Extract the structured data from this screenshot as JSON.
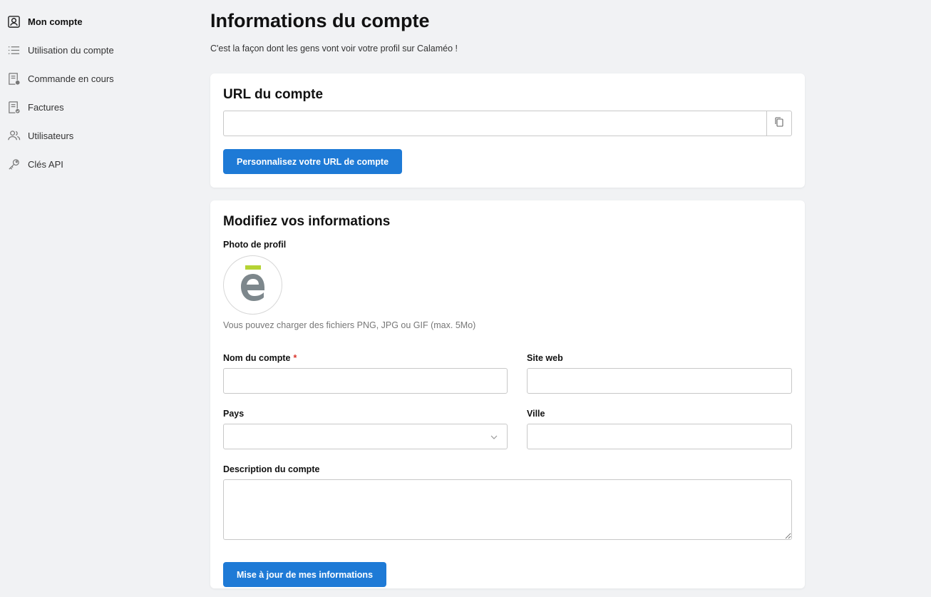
{
  "sidebar": {
    "items": [
      {
        "label": "Mon compte",
        "icon": "account-box-icon",
        "active": true
      },
      {
        "label": "Utilisation du compte",
        "icon": "list-icon"
      },
      {
        "label": "Commande en cours",
        "icon": "order-document-icon"
      },
      {
        "label": "Factures",
        "icon": "invoice-icon"
      },
      {
        "label": "Utilisateurs",
        "icon": "users-icon"
      },
      {
        "label": "Clés API",
        "icon": "key-icon"
      }
    ]
  },
  "page": {
    "title": "Informations du compte",
    "subtitle": "C'est la façon dont les gens vont voir votre profil sur Calaméo !"
  },
  "url_card": {
    "title": "URL du compte",
    "url_value": "",
    "copy_icon": "copy-icon",
    "customize_button": "Personnalisez votre URL de compte"
  },
  "info_card": {
    "title": "Modifiez vos informations",
    "photo_label": "Photo de profil",
    "avatar_letter": "ē",
    "photo_hint": "Vous pouvez charger des fichiers PNG, JPG ou GIF (max. 5Mo)",
    "account_name_label": "Nom du compte",
    "required_mark": "*",
    "account_name_value": "",
    "website_label": "Site web",
    "website_value": "",
    "country_label": "Pays",
    "country_value": "",
    "city_label": "Ville",
    "city_value": "",
    "description_label": "Description du compte",
    "description_value": "",
    "submit_button": "Mise à jour de mes informations"
  },
  "colors": {
    "primary": "#1e7ad6",
    "background": "#f1f2f4",
    "avatar_accent": "#b5d334",
    "avatar_gray": "#7d878c",
    "required": "#d9342b"
  }
}
